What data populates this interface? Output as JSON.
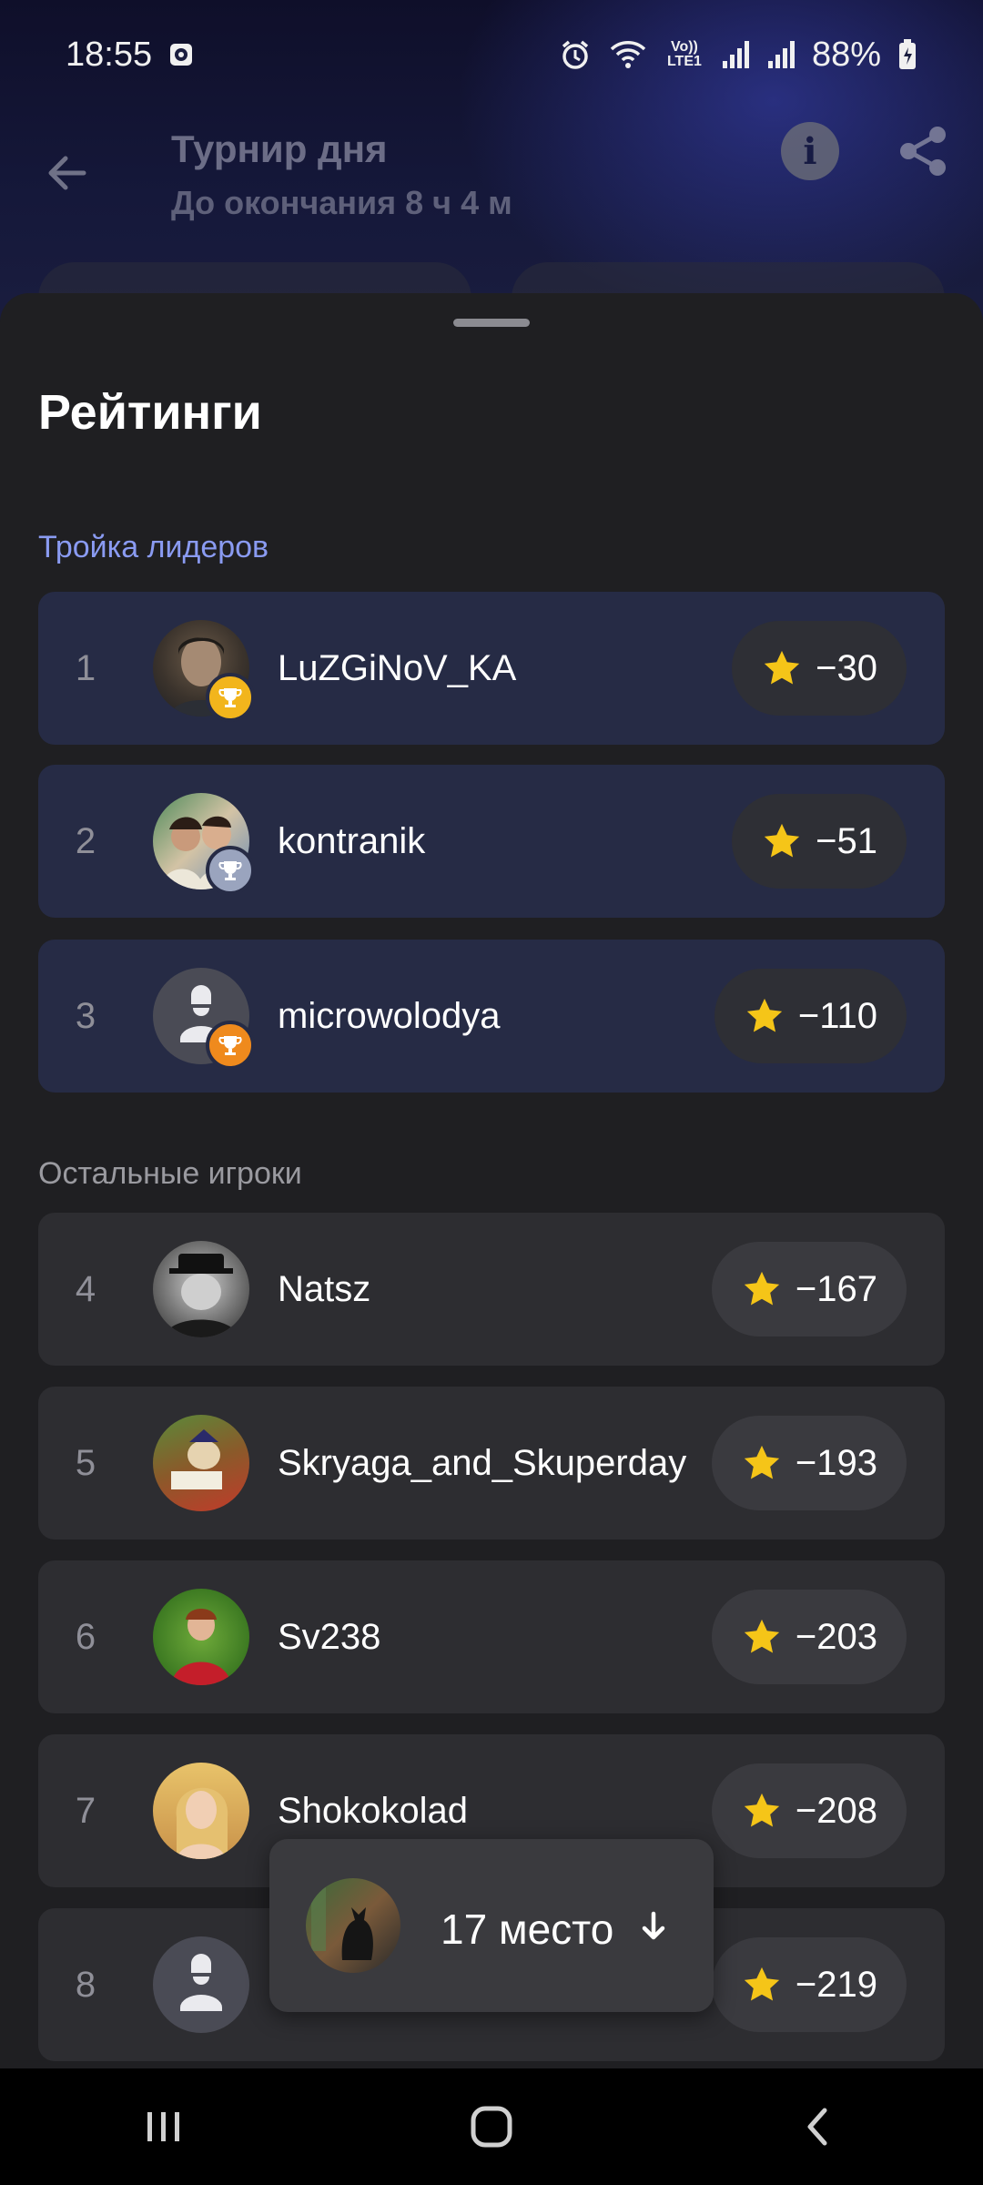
{
  "status_bar": {
    "time": "18:55",
    "battery": "88%",
    "network_label": "Vo)) LTE1"
  },
  "header": {
    "title": "Турнир дня",
    "subtitle": "До окончания 8 ч 4 м"
  },
  "sheet": {
    "title": "Рейтинги",
    "leaders_label": "Тройка лидеров",
    "others_label": "Остальные игроки"
  },
  "leaders": [
    {
      "rank": "1",
      "name": "LuZGiNoV_KA",
      "score": "−30",
      "trophy": "gold"
    },
    {
      "rank": "2",
      "name": "kontranik",
      "score": "−51",
      "trophy": "silver"
    },
    {
      "rank": "3",
      "name": "microwolodya",
      "score": "−110",
      "trophy": "bronze"
    }
  ],
  "others": [
    {
      "rank": "4",
      "name": "Natsz",
      "score": "−167"
    },
    {
      "rank": "5",
      "name": "Skryaga_and_Skuperday",
      "score": "−193"
    },
    {
      "rank": "6",
      "name": "Sv238",
      "score": "−203"
    },
    {
      "rank": "7",
      "name": "Shokokolad",
      "score": "−208"
    },
    {
      "rank": "8",
      "name": "",
      "score": "−219"
    }
  ],
  "my_place": {
    "label": "17 место"
  },
  "colors": {
    "accent_label": "#8a9bf2",
    "leader_row": "#262b45",
    "other_row": "#2d2d31",
    "star": "#f5c518",
    "gold": "#f2b51c",
    "silver": "#9aa4be",
    "bronze": "#ef8a1d"
  },
  "icons": {
    "back": "arrow-left-icon",
    "info": "info-icon",
    "share": "share-icon",
    "star": "star-icon",
    "trophy": "trophy-icon",
    "arrow_down": "arrow-down-icon"
  }
}
